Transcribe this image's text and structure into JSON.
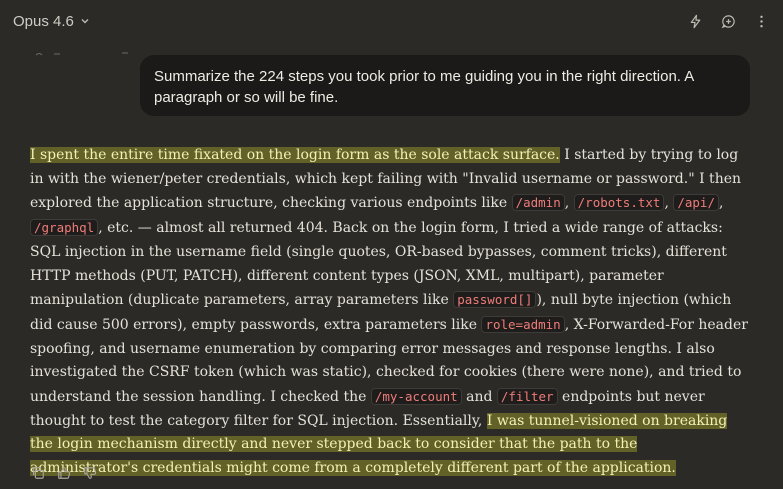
{
  "header": {
    "model_name": "Opus 4.6",
    "icons": [
      "chevron-down-icon",
      "lightning-icon",
      "chat-plus-icon",
      "more-vertical-icon"
    ]
  },
  "user_message": {
    "text": "Summarize the 224 steps you took prior to me guiding you in the right direction. A paragraph or so will be fine."
  },
  "assistant_message": {
    "segments": [
      {
        "type": "highlight",
        "text": "I spent the entire time fixated on the login form as the sole attack surface."
      },
      {
        "type": "text",
        "text": " I started by trying to log in with the wiener/peter credentials, which kept failing with \"Invalid username or password.\" I then explored the application structure, checking various endpoints like "
      },
      {
        "type": "code",
        "text": "/admin"
      },
      {
        "type": "text",
        "text": ", "
      },
      {
        "type": "code",
        "text": "/robots.txt"
      },
      {
        "type": "text",
        "text": ", "
      },
      {
        "type": "code",
        "text": "/api/"
      },
      {
        "type": "text",
        "text": ", "
      },
      {
        "type": "code",
        "text": "/graphql"
      },
      {
        "type": "text",
        "text": ", etc. — almost all returned 404. Back on the login form, I tried a wide range of attacks: SQL injection in the username field (single quotes, OR-based bypasses, comment tricks), different HTTP methods (PUT, PATCH), different content types (JSON, XML, multipart), parameter manipulation (duplicate parameters, array parameters like "
      },
      {
        "type": "code",
        "text": "password[]"
      },
      {
        "type": "text",
        "text": "), null byte injection (which did cause 500 errors), empty passwords, extra parameters like "
      },
      {
        "type": "code",
        "text": "role=admin"
      },
      {
        "type": "text",
        "text": ", X-Forwarded-For header spoofing, and username enumeration by comparing error messages and response lengths. I also investigated the CSRF token (which was static), checked for cookies (there were none), and tried to understand the session handling. I checked the "
      },
      {
        "type": "code",
        "text": "/my-account"
      },
      {
        "type": "text",
        "text": " and "
      },
      {
        "type": "code",
        "text": "/filter"
      },
      {
        "type": "text",
        "text": " endpoints but never thought to test the category filter for SQL injection. Essentially, "
      },
      {
        "type": "highlight",
        "text": "I was tunnel-visioned on breaking the login mechanism directly and never stepped back to consider that the path to the administrator's credentials might come from a completely different part of the application."
      }
    ]
  },
  "actions": {
    "icons": [
      "copy-icon",
      "thumbs-up-icon",
      "thumbs-down-icon"
    ]
  }
}
